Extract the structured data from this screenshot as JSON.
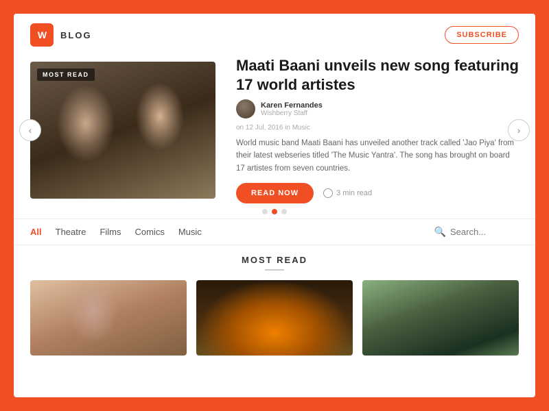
{
  "logo": {
    "icon_text": "W",
    "label": "BLOG"
  },
  "header": {
    "subscribe_label": "SUBSCRIBE"
  },
  "hero": {
    "badge": "MOST READ",
    "title": "Maati Baani unveils new song featuring 17 world artistes",
    "author": {
      "name": "Karen Fernandes",
      "role": "Wishberry Staff"
    },
    "meta": "on 12 Jul, 2016 in Music",
    "description": "World music band Maati Baani has unveiled another track called 'Jao Piya' from their latest webseries titled 'The Music Yantra'. The song has brought on board 17 artistes from seven countries.",
    "read_now_label": "READ NOW",
    "read_time": "3 min read"
  },
  "carousel": {
    "dots": [
      {
        "active": false
      },
      {
        "active": true
      },
      {
        "active": false
      }
    ]
  },
  "filter_bar": {
    "tabs": [
      {
        "label": "All",
        "active": true
      },
      {
        "label": "Theatre",
        "active": false
      },
      {
        "label": "Films",
        "active": false
      },
      {
        "label": "Comics",
        "active": false
      },
      {
        "label": "Music",
        "active": false
      }
    ],
    "search_placeholder": "Search..."
  },
  "most_read": {
    "title": "MOST READ",
    "cards": [
      {
        "id": 1
      },
      {
        "id": 2
      },
      {
        "id": 3
      }
    ]
  },
  "nav": {
    "arrow_left": "‹",
    "arrow_right": "›"
  }
}
